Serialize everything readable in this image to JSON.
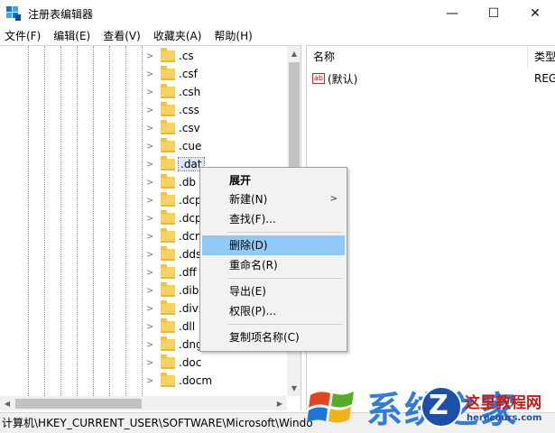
{
  "window": {
    "title": "注册表编辑器",
    "minimize_glyph": "—",
    "maximize_glyph": "☐",
    "close_glyph": "✕"
  },
  "menubar": [
    "文件(F)",
    "编辑(E)",
    "查看(V)",
    "收藏夹(A)",
    "帮助(H)"
  ],
  "tree": {
    "items": [
      ".cs",
      ".csf",
      ".csh",
      ".css",
      ".csv",
      ".cue",
      ".dat",
      ".db",
      ".dcp",
      ".dcp",
      ".dcr",
      ".dds",
      ".dff",
      ".dib",
      ".divx",
      ".dll",
      ".dng",
      ".doc",
      ".docm"
    ],
    "selected_index": 6
  },
  "right_pane": {
    "columns": {
      "name": "名称",
      "type": "类型"
    },
    "values": [
      {
        "icon": "ab",
        "name": "(默认)",
        "type": "REG"
      }
    ]
  },
  "context_menu": {
    "items": [
      "展开",
      "新建(N)",
      "查找(F)...",
      "删除(D)",
      "重命名(R)",
      "导出(E)",
      "权限(P)...",
      "复制项名称(C)"
    ],
    "highlighted_index": 3,
    "bold_index": 0,
    "submenu_index": 1
  },
  "statusbar": {
    "path": "计算机\\HKEY_CURRENT_USER\\SOFTWARE\\Microsoft\\Windo"
  },
  "watermark": {
    "brand_cn": "系统之家",
    "site_name_cn": "这里教程网",
    "site_url": "herecours.com",
    "badge_letter": "Z"
  },
  "colors": {
    "selection": "#91c9f7",
    "folder": "#f7d263"
  },
  "icons": [
    "registry-editor-icon",
    "folder-icon",
    "chevron-right-icon",
    "string-value-ab-icon",
    "windows-logo-icon"
  ]
}
